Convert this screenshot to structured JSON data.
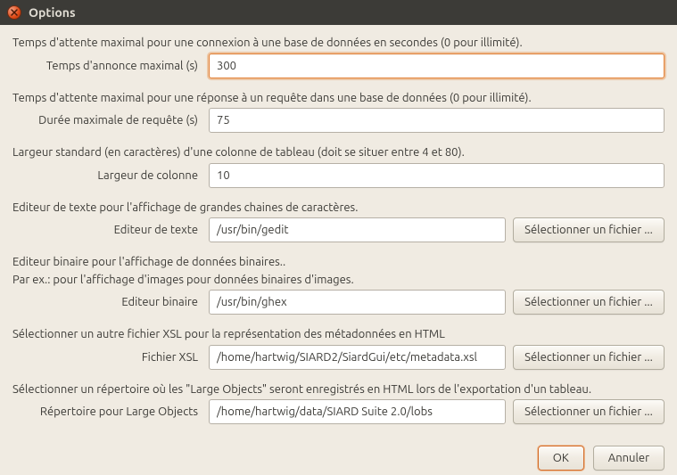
{
  "window": {
    "title": "Options"
  },
  "groups": {
    "connTimeout": {
      "desc": "Temps d'attente maximal pour une connexion à une base de données en secondes (0 pour illimité).",
      "label": "Temps d'annonce maximal (s)",
      "value": "300"
    },
    "queryTimeout": {
      "desc": "Temps d'attente maximal pour une réponse à un requête dans une base de données (0 pour illimité).",
      "label": "Durée maximale de requête (s)",
      "value": "75"
    },
    "colWidth": {
      "desc": "Largeur standard (en caractères) d'une colonne de tableau (doit se situer entre 4 et 80).",
      "label": "Largeur de colonne",
      "value": "10"
    },
    "textEditor": {
      "desc": "Editeur de texte pour l'affichage de grandes chaines de caractères.",
      "label": "Editeur de texte",
      "value": "/usr/bin/gedit",
      "button": "Sélectionner un fichier ..."
    },
    "binEditor": {
      "desc1": "Editeur binaire pour l'affichage de données binaires..",
      "desc2": "Par ex.: pour l'affichage d'images pour données binaires d'images.",
      "label": "Editeur binaire",
      "value": "/usr/bin/ghex",
      "button": "Sélectionner un fichier ..."
    },
    "xslFile": {
      "desc": "Sélectionner un autre fichier XSL pour la représentation des métadonnées en HTML",
      "label": "Fichier XSL",
      "value": "/home/hartwig/SIARD2/SiardGui/etc/metadata.xsl",
      "button": "Sélectionner un fichier ..."
    },
    "lobDir": {
      "desc": "Sélectionner un répertoire où les \"Large Objects\" seront enregistrés en HTML lors de l'exportation d'un tableau.",
      "label": "Répertoire pour Large Objects",
      "value": "/home/hartwig/data/SIARD Suite 2.0/lobs",
      "button": "Sélectionner un fichier ..."
    }
  },
  "footer": {
    "ok": "OK",
    "cancel": "Annuler"
  }
}
